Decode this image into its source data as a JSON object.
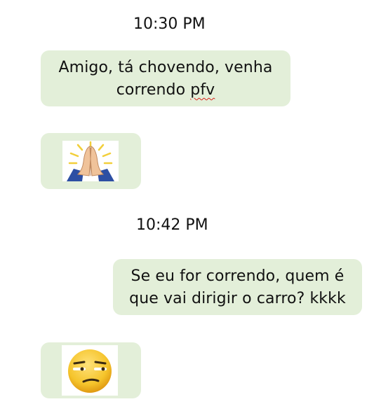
{
  "messages": [
    {
      "time": "10:30 PM",
      "text_line1": "Amigo, tá chovendo, venha",
      "text_line2_pre": "correndo ",
      "text_line2_flagged": "pfv",
      "emoji": "praying-hands-icon"
    },
    {
      "time": "10:42 PM",
      "text_line1": "Se eu for correndo, quem é",
      "text_line2": "que vai dirigir o carro? kkkk",
      "emoji": "unamused-face-icon"
    }
  ],
  "colors": {
    "bubble": "#e3efd9",
    "spellcheck_underline": "#d9221c",
    "emoji_yellow": "#f5c42b",
    "sleeve_blue": "#2d4fa3"
  }
}
